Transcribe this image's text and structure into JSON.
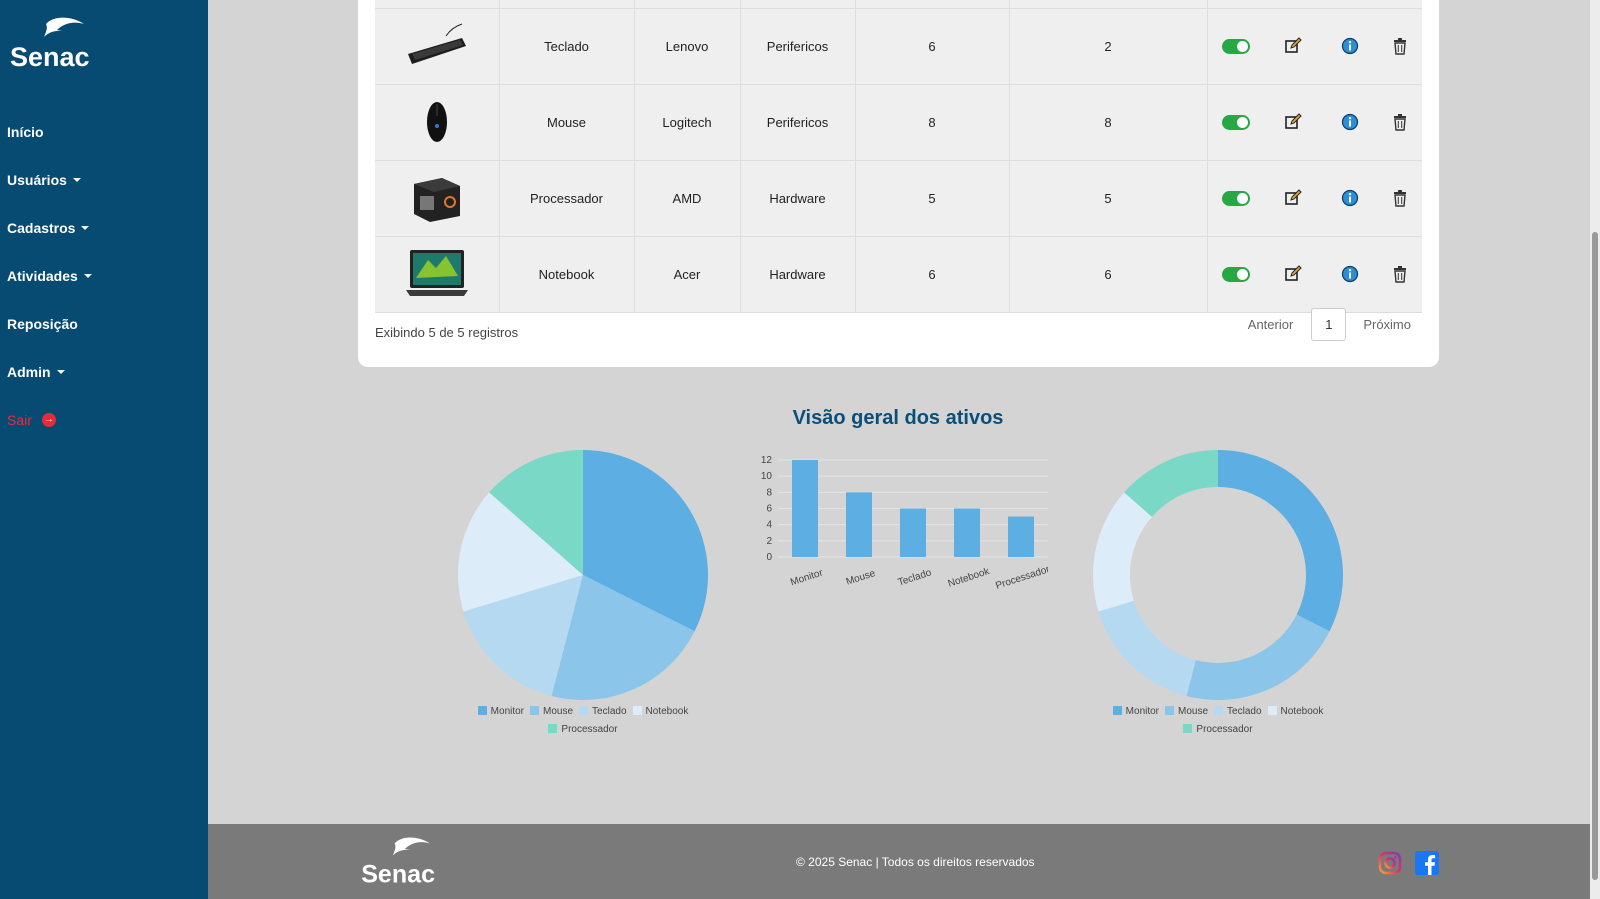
{
  "brand": {
    "logo_text": "Senac"
  },
  "sidebar": {
    "items": [
      {
        "label": "Início",
        "dropdown": false
      },
      {
        "label": "Usuários",
        "dropdown": true
      },
      {
        "label": "Cadastros",
        "dropdown": true
      },
      {
        "label": "Atividades",
        "dropdown": true
      },
      {
        "label": "Reposição",
        "dropdown": false
      },
      {
        "label": "Admin",
        "dropdown": true
      },
      {
        "label": "Sair",
        "dropdown": false,
        "icon": "exit-icon"
      }
    ]
  },
  "table": {
    "rows": [
      {
        "image": "keyboard-image",
        "name": "Teclado",
        "brand": "Lenovo",
        "category": "Perifericos",
        "qty1": "6",
        "qty2": "2",
        "active": true
      },
      {
        "image": "mouse-image",
        "name": "Mouse",
        "brand": "Logitech",
        "category": "Perifericos",
        "qty1": "8",
        "qty2": "8",
        "active": true
      },
      {
        "image": "processor-image",
        "name": "Processador",
        "brand": "AMD",
        "category": "Hardware",
        "qty1": "5",
        "qty2": "5",
        "active": true
      },
      {
        "image": "notebook-image",
        "name": "Notebook",
        "brand": "Acer",
        "category": "Hardware",
        "qty1": "6",
        "qty2": "6",
        "active": true
      }
    ],
    "actions": [
      "edit-icon",
      "info-icon",
      "trash-icon"
    ],
    "footer_text": "Exibindo 5 de 5 registros"
  },
  "pagination": {
    "prev": "Anterior",
    "page": "1",
    "next": "Próximo"
  },
  "charts_title": "Visão geral dos ativos",
  "chart_data": [
    {
      "type": "pie",
      "categories": [
        "Monitor",
        "Mouse",
        "Teclado",
        "Notebook",
        "Processador"
      ],
      "values": [
        12,
        8,
        6,
        6,
        5
      ],
      "colors": [
        "#5daee3",
        "#8cc5ea",
        "#b4d9f1",
        "#dcecf8",
        "#7ad9c6"
      ],
      "legend_position": "bottom"
    },
    {
      "type": "bar",
      "categories": [
        "Monitor",
        "Mouse",
        "Teclado",
        "Notebook",
        "Processador"
      ],
      "values": [
        12,
        8,
        6,
        6,
        5
      ],
      "ylim": [
        0,
        12
      ],
      "yticks": [
        "0",
        "2",
        "4",
        "6",
        "8",
        "10",
        "12"
      ],
      "color": "#5daee3",
      "grid": true
    },
    {
      "type": "pie",
      "variant": "doughnut",
      "categories": [
        "Monitor",
        "Mouse",
        "Teclado",
        "Notebook",
        "Processador"
      ],
      "values": [
        12,
        8,
        6,
        6,
        5
      ],
      "colors": [
        "#5daee3",
        "#8cc5ea",
        "#b4d9f1",
        "#dcecf8",
        "#7ad9c6"
      ],
      "legend_position": "bottom"
    }
  ],
  "footer": {
    "copyright": "© 2025 Senac | Todos os direitos reservados",
    "social": [
      "instagram-icon",
      "facebook-icon"
    ]
  },
  "colors": {
    "sidebar": "#074a72",
    "toggle_on": "#28a745",
    "sair": "#e52b3a",
    "title": "#0a4f7a"
  }
}
